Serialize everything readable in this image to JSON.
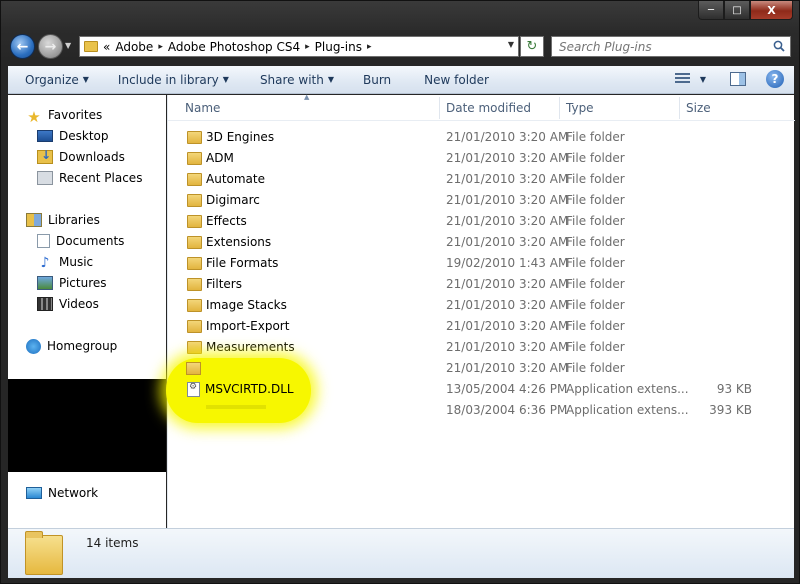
{
  "window": {
    "caption_buttons": {
      "minimize": "─",
      "maximize": "□",
      "close": "X"
    }
  },
  "nav": {
    "back_glyph": "←",
    "forward_glyph": "→",
    "recent_glyph": "▼",
    "refresh_glyph": "↻"
  },
  "address": {
    "overflow": "«",
    "separator": "▸",
    "crumbs": [
      "Adobe",
      "Adobe Photoshop CS4",
      "Plug-ins"
    ],
    "dropdown_glyph": "▼"
  },
  "search": {
    "placeholder": "Search Plug-ins"
  },
  "commandbar": {
    "organize": "Organize",
    "include": "Include in library",
    "share": "Share with",
    "burn": "Burn",
    "new_folder": "New folder",
    "dropdown_glyph": "▼",
    "help_glyph": "?"
  },
  "sidebar": {
    "favorites": "Favorites",
    "desktop": "Desktop",
    "downloads": "Downloads",
    "recent": "Recent Places",
    "libraries": "Libraries",
    "documents": "Documents",
    "music": "Music",
    "pictures": "Pictures",
    "videos": "Videos",
    "homegroup": "Homegroup",
    "network": "Network"
  },
  "columns": {
    "name": "Name",
    "date": "Date modified",
    "type": "Type",
    "size": "Size",
    "sort_glyph": "▲"
  },
  "files": [
    {
      "name": "3D Engines",
      "date": "21/01/2010 3:20 AM",
      "type": "File folder",
      "size": ""
    },
    {
      "name": "ADM",
      "date": "21/01/2010 3:20 AM",
      "type": "File folder",
      "size": ""
    },
    {
      "name": "Automate",
      "date": "21/01/2010 3:20 AM",
      "type": "File folder",
      "size": ""
    },
    {
      "name": "Digimarc",
      "date": "21/01/2010 3:20 AM",
      "type": "File folder",
      "size": ""
    },
    {
      "name": "Effects",
      "date": "21/01/2010 3:20 AM",
      "type": "File folder",
      "size": ""
    },
    {
      "name": "Extensions",
      "date": "21/01/2010 3:20 AM",
      "type": "File folder",
      "size": ""
    },
    {
      "name": "File Formats",
      "date": "19/02/2010 1:43 AM",
      "type": "File folder",
      "size": ""
    },
    {
      "name": "Filters",
      "date": "21/01/2010 3:20 AM",
      "type": "File folder",
      "size": ""
    },
    {
      "name": "Image Stacks",
      "date": "21/01/2010 3:20 AM",
      "type": "File folder",
      "size": ""
    },
    {
      "name": "Import-Export",
      "date": "21/01/2010 3:20 AM",
      "type": "File folder",
      "size": ""
    },
    {
      "name": "Measurements",
      "date": "21/01/2010 3:20 AM",
      "type": "File folder",
      "size": ""
    },
    {
      "name": "",
      "date": "21/01/2010 3:20 AM",
      "type": "File folder",
      "size": ""
    },
    {
      "name": "MSVCIRTD.DLL",
      "date": "13/05/2004 4:26 PM",
      "type": "Application extens...",
      "size": "93 KB"
    },
    {
      "name": "",
      "date": "18/03/2004 6:36 PM",
      "type": "Application extens...",
      "size": "393 KB"
    }
  ],
  "status": {
    "item_count": "14 items"
  },
  "colors": {
    "highlight": "#f7f700",
    "command_text": "#1e395b",
    "secondary_text": "#6d6d6d"
  }
}
